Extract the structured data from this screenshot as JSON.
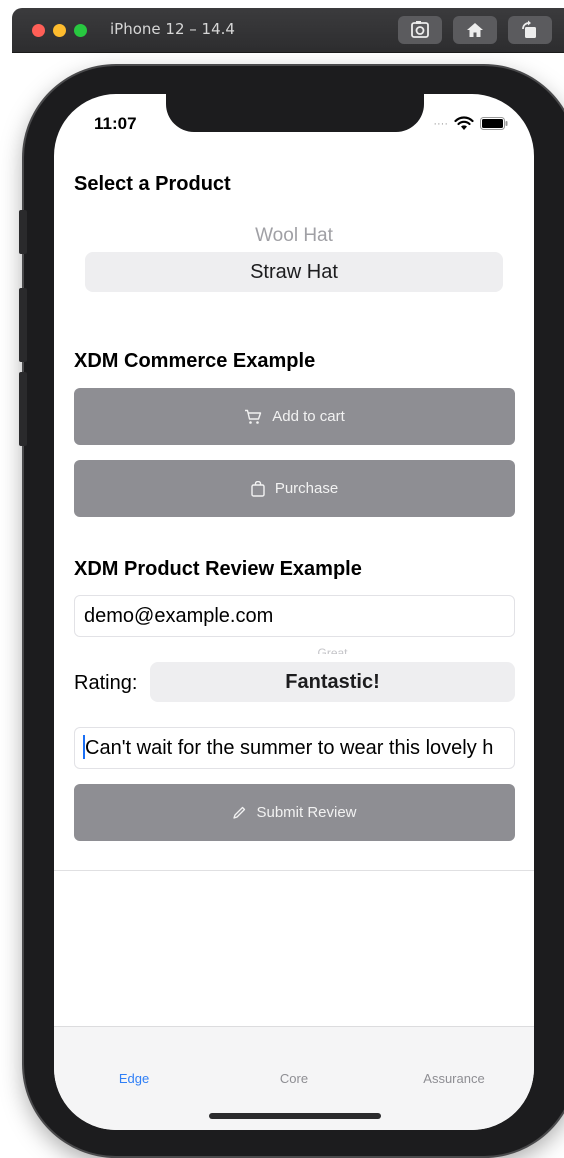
{
  "window": {
    "title": "iPhone 12 – 14.4",
    "toolbar_buttons": [
      "screenshot-icon",
      "home-icon",
      "rotate-icon"
    ]
  },
  "status_bar": {
    "time": "11:07",
    "icons": [
      "signal-dots-icon",
      "wifi-icon",
      "battery-icon"
    ]
  },
  "product_section": {
    "title": "Select a Product",
    "picker_above": "Wool Hat",
    "picker_selected": "Straw Hat"
  },
  "commerce_section": {
    "title": "XDM Commerce Example",
    "add_to_cart_label": "Add to cart",
    "add_to_cart_icon": "cart-icon",
    "purchase_label": "Purchase",
    "purchase_icon": "bag-icon"
  },
  "review_section": {
    "title": "XDM Product Review Example",
    "email_value": "demo@example.com",
    "rating_label": "Rating:",
    "rating_above": "Great",
    "rating_selected": "Fantastic!",
    "review_text": "Can't wait for the summer to wear this lovely h",
    "submit_label": "Submit Review",
    "submit_icon": "pencil-icon"
  },
  "colors": {
    "button_gray": "#8e8e93",
    "picker_bg": "#eeeef0",
    "tab_active": "#2f7ff6",
    "tab_inactive": "#8e8e93"
  },
  "tabs": [
    {
      "label": "Edge",
      "active": true
    },
    {
      "label": "Core",
      "active": false
    },
    {
      "label": "Assurance",
      "active": false
    }
  ]
}
